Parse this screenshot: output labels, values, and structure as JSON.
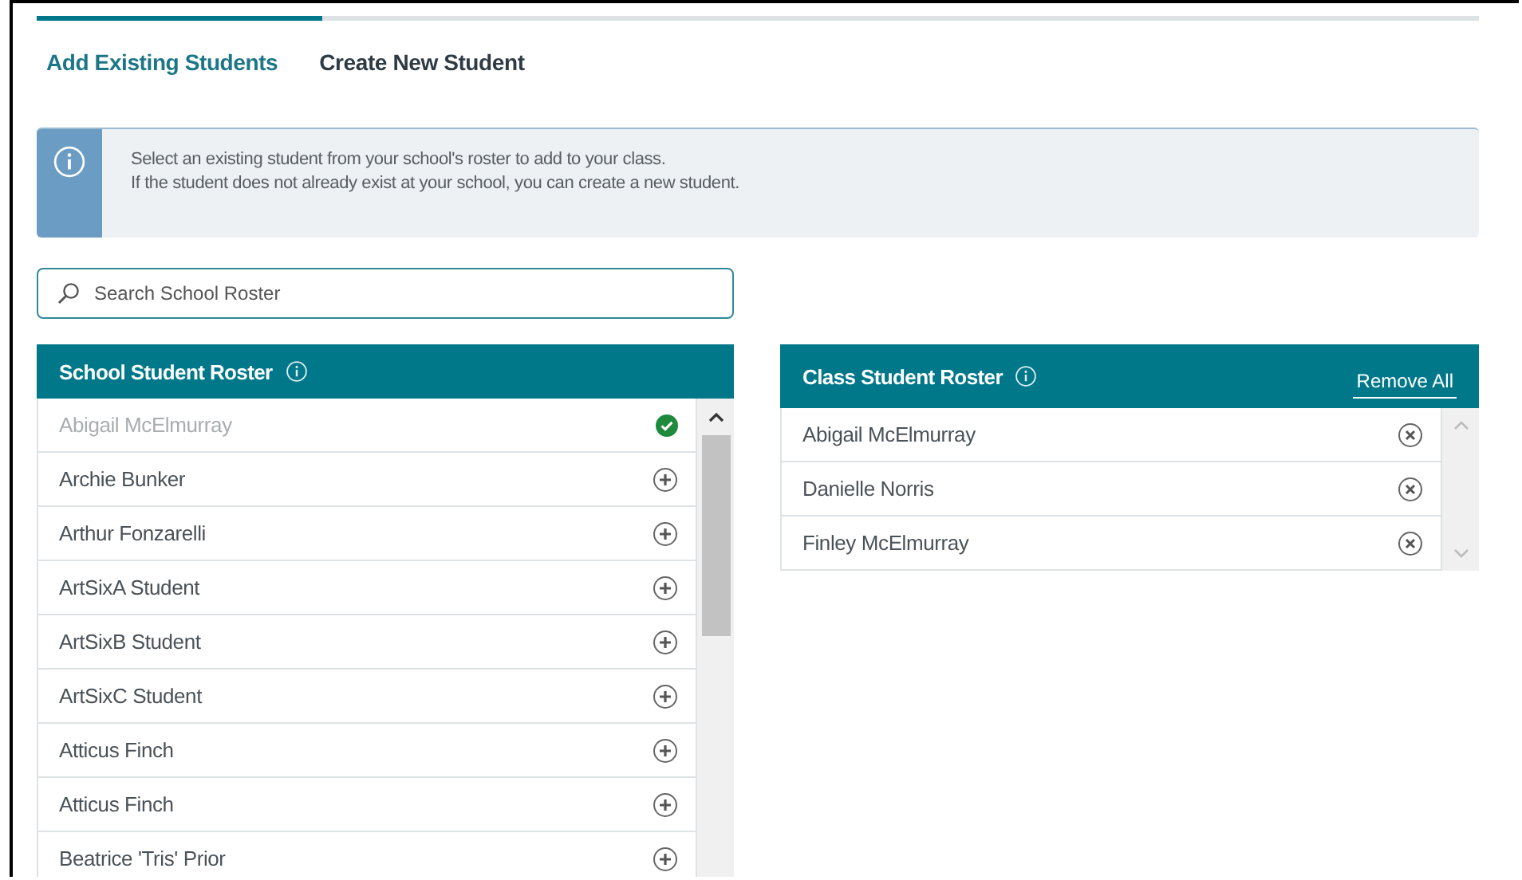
{
  "tabs": [
    {
      "label": "Add Existing Students",
      "selected": true
    },
    {
      "label": "Create New Student",
      "selected": false
    }
  ],
  "info": {
    "lines": [
      "Select an existing student from your school's roster to add to your class.",
      "If the student does not already exist at your school, you can create a new student."
    ]
  },
  "search": {
    "placeholder": "Search School Roster"
  },
  "school_roster": {
    "title": "School Student Roster",
    "rows": [
      {
        "name": "Abigail McElmurray",
        "added": true
      },
      {
        "name": "Archie Bunker",
        "added": false
      },
      {
        "name": "Arthur Fonzarelli",
        "added": false
      },
      {
        "name": "ArtSixA Student",
        "added": false
      },
      {
        "name": "ArtSixB Student",
        "added": false
      },
      {
        "name": "ArtSixC Student",
        "added": false
      },
      {
        "name": "Atticus Finch",
        "added": false
      },
      {
        "name": "Atticus Finch",
        "added": false
      },
      {
        "name": "Beatrice 'Tris' Prior",
        "added": false
      }
    ]
  },
  "class_roster": {
    "title": "Class Student Roster",
    "action": "Remove All",
    "rows": [
      {
        "name": "Abigail McElmurray"
      },
      {
        "name": "Danielle Norris"
      },
      {
        "name": "Finley McElmurray"
      }
    ]
  }
}
